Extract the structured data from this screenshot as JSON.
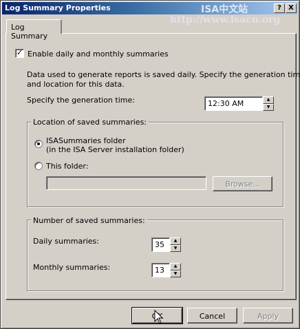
{
  "window": {
    "title": "Log Summary Properties",
    "help_button": "?",
    "close_button": "X",
    "watermark_brand": "ISA中文站",
    "watermark_url": "http://www.isacn.org"
  },
  "tabs": [
    {
      "label": "Log Summary"
    }
  ],
  "summary": {
    "enable_label": "Enable daily and monthly summaries",
    "enable_checked": true,
    "description": "Data used to generate reports is saved daily. Specify the generation time and location for this data.",
    "description_line1": "Data used to generate reports is saved daily. Specify the generation time",
    "description_line2": "and location for this data.",
    "time_label": "Specify the generation time:",
    "time_value": "12:30 AM"
  },
  "location": {
    "legend": "Location of saved summaries:",
    "option1_line1": "ISASummaries folder",
    "option1_line2": "(in the ISA Server installation folder)",
    "option2_label": "This folder:",
    "folder_value": "",
    "browse_label": "Browse..."
  },
  "count": {
    "legend": "Number of saved summaries:",
    "daily_label": "Daily summaries:",
    "daily_value": "35",
    "monthly_label": "Monthly summaries:",
    "monthly_value": "13"
  },
  "buttons": {
    "ok": "OK",
    "cancel": "Cancel",
    "apply": "Apply"
  }
}
